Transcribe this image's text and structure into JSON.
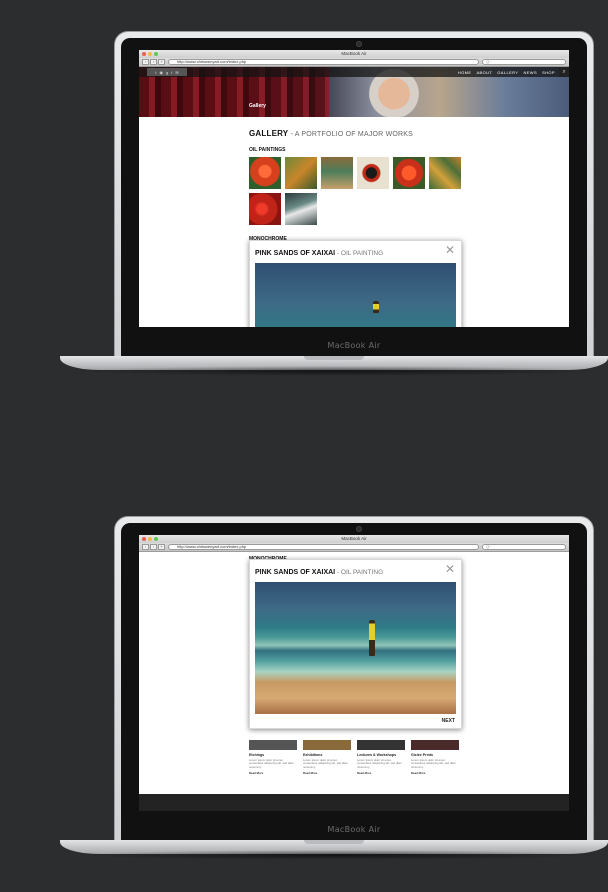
{
  "browser": {
    "window_title": "MacBook Air",
    "url": "http://www.chriswenyart.com/index.php",
    "search_placeholder": "Q~"
  },
  "laptop_brand": "MacBook Air",
  "site": {
    "menu": [
      "HOME",
      "ABOUT",
      "GALLERY",
      "NEWS",
      "SHOP"
    ],
    "social_icons": [
      "twitter-icon",
      "rss-icon",
      "google-plus-icon",
      "facebook-icon",
      "email-icon"
    ],
    "hero_label": "Gallery",
    "page_title": "GALLERY",
    "page_subtitle": " - A PORTFOLIO OF MAJOR WORKS",
    "oil_heading": "OIL PAINTINGS",
    "mono_heading": "MONOCHROME",
    "oil_thumbs": [
      "#d7401d",
      "#5a7a3a",
      "#8a6a3a",
      "#c8c1b0",
      "#c9301a",
      "#4d6f3a",
      "#c02418",
      "#4f6a66"
    ]
  },
  "modal": {
    "title": "PINK SANDS OF XAIXAI",
    "subtitle": " - OIL PAINTING",
    "close_symbol": "✕",
    "next_label": "NEXT"
  },
  "features": [
    {
      "title": "Etchings",
      "desc": "Lorem ipsum dolor sit amet, consectetur adipiscing elit, sed diam nonummy.",
      "more": "Read More"
    },
    {
      "title": "Exhibitions",
      "desc": "Lorem ipsum dolor sit amet, consectetur adipiscing elit, sed diam nonummy.",
      "more": "Read More"
    },
    {
      "title": "Lectures & Workshops",
      "desc": "Lorem ipsum dolor sit amet, consectetur adipiscing elit, sed diam nonummy.",
      "more": "Read More"
    },
    {
      "title": "Giclee Prints",
      "desc": "Lorem ipsum dolor sit amet, consectetur adipiscing elit, sed diam nonummy.",
      "more": "Read More"
    }
  ],
  "colors": {
    "background": "#2b2d2f",
    "accent_dark": "#232323"
  }
}
